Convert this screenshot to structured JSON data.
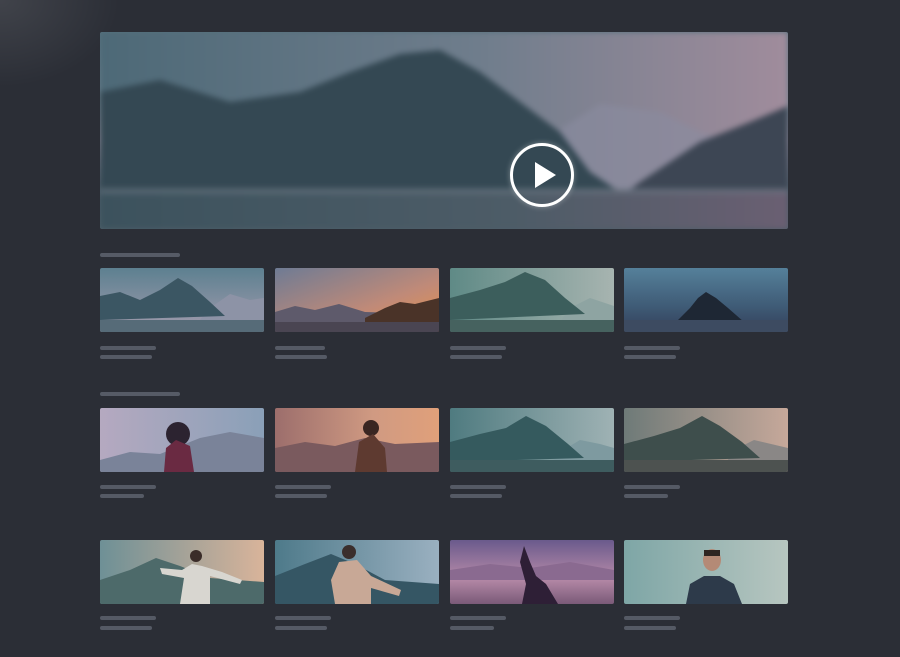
{
  "colors": {
    "background": "#2b2e36",
    "placeholder_line": "#555a65",
    "play_ring": "#ffffff"
  },
  "hero": {
    "icon": "play-circle-icon"
  },
  "rows": [
    {
      "thumbnails": [
        "mountain-lake-dusk",
        "mountain-sunset-orange",
        "teal-mountain-lake",
        "dark-peak-night"
      ]
    },
    {
      "thumbnails": [
        "woman-hair-wind",
        "woman-sunset-mountains",
        "teal-valley",
        "misty-valley"
      ]
    },
    {
      "thumbnails": [
        "man-dancing-lake",
        "dancer-teal-lake",
        "dancer-purple-sunset",
        "man-portrait"
      ]
    }
  ]
}
